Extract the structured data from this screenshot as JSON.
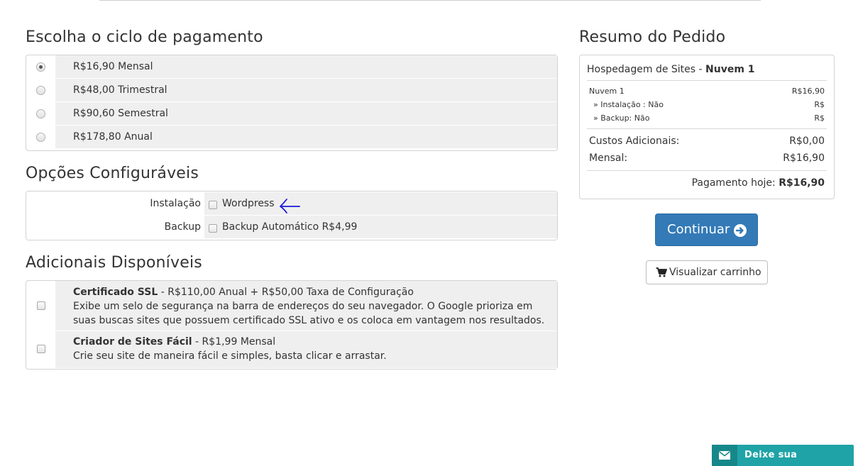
{
  "billing": {
    "title": "Escolha o ciclo de pagamento",
    "options": [
      {
        "label": "R$16,90 Mensal",
        "selected": true
      },
      {
        "label": "R$48,00 Trimestral",
        "selected": false
      },
      {
        "label": "R$90,60 Semestral",
        "selected": false
      },
      {
        "label": "R$178,80 Anual",
        "selected": false
      }
    ]
  },
  "config": {
    "title": "Opções Configuráveis",
    "options": [
      {
        "label": "Instalação",
        "value": "Wordpress",
        "checked": false
      },
      {
        "label": "Backup",
        "value": "Backup Automático R$4,99",
        "checked": false
      }
    ]
  },
  "addons": {
    "title": "Adicionais Disponíveis",
    "items": [
      {
        "name": "Certificado SSL",
        "price": " - R$110,00 Anual + R$50,00 Taxa de Configuração",
        "description": "Exibe um selo de segurança na barra de endereços do seu navegador. O Google prioriza em suas buscas sites que possuem certificado SSL ativo e os coloca em vantagem nos resultados.",
        "checked": false
      },
      {
        "name": "Criador de Sites Fácil",
        "price": " - R$1,99 Mensal",
        "description": "Crie seu site de maneira fácil e simples, basta clicar e arrastar.",
        "checked": false
      }
    ]
  },
  "summary": {
    "title": "Resumo do Pedido",
    "product_group": "Hospedagem de Sites - ",
    "product_name": "Nuvem 1",
    "line_item": {
      "label": "Nuvem 1",
      "value": "R$16,90"
    },
    "sub_items": [
      {
        "label": "» Instalação : Não",
        "value": "R$"
      },
      {
        "label": "» Backup: Não",
        "value": "R$"
      }
    ],
    "additional_costs": {
      "label": "Custos Adicionais:",
      "value": "R$0,00"
    },
    "monthly": {
      "label": "Mensal:",
      "value": "R$16,90"
    },
    "today": {
      "label": "Pagamento hoje: ",
      "value": "R$16,90"
    }
  },
  "actions": {
    "continue_label": "Continuar",
    "cart_label": "Visualizar carrinho"
  },
  "chat": {
    "label": "Deixe sua mensagem."
  },
  "colors": {
    "primary": "#337ab7",
    "chat": "#1fa3a6",
    "annotation_arrow": "#1a1adb"
  }
}
